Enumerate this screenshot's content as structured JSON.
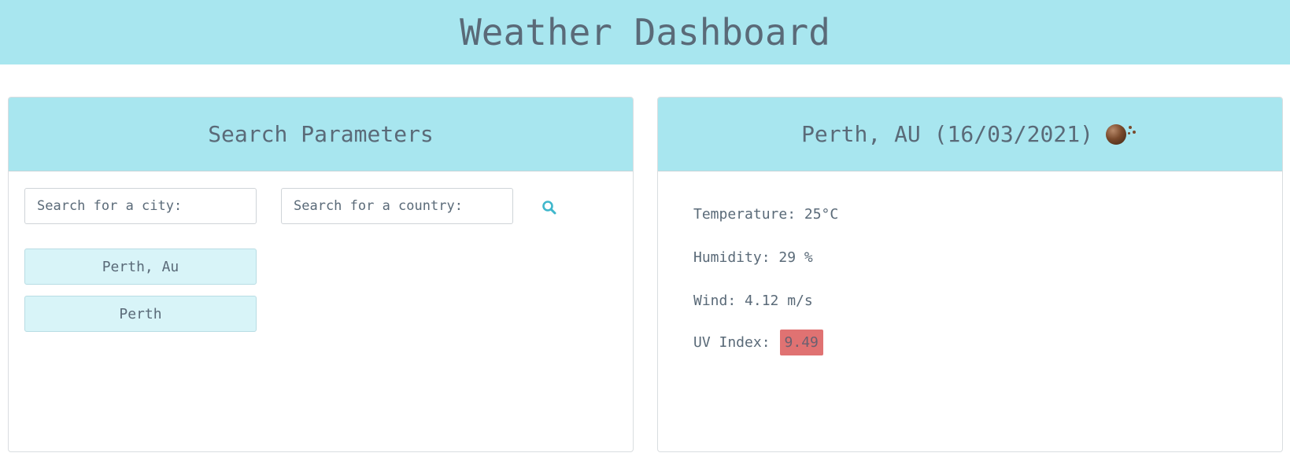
{
  "header": {
    "title": "Weather Dashboard"
  },
  "search_panel": {
    "title": "Search Parameters",
    "city_placeholder": "Search for a city:",
    "country_placeholder": "Search for a country:",
    "search_icon": "search-icon",
    "history": [
      "Perth, Au",
      "Perth"
    ]
  },
  "weather_panel": {
    "title": "Perth, AU (16/03/2021)",
    "weather_icon": "weather-condition-icon",
    "temperature": "Temperature: 25°C",
    "humidity": "Humidity: 29 %",
    "wind": "Wind: 4.12 m/s",
    "uv_label": "UV Index:",
    "uv_value": "9.49",
    "uv_color": "#e07272"
  },
  "colors": {
    "header_bg": "#a8e6ef",
    "history_bg": "#d8f4f8",
    "accent": "#3fb7cc"
  }
}
